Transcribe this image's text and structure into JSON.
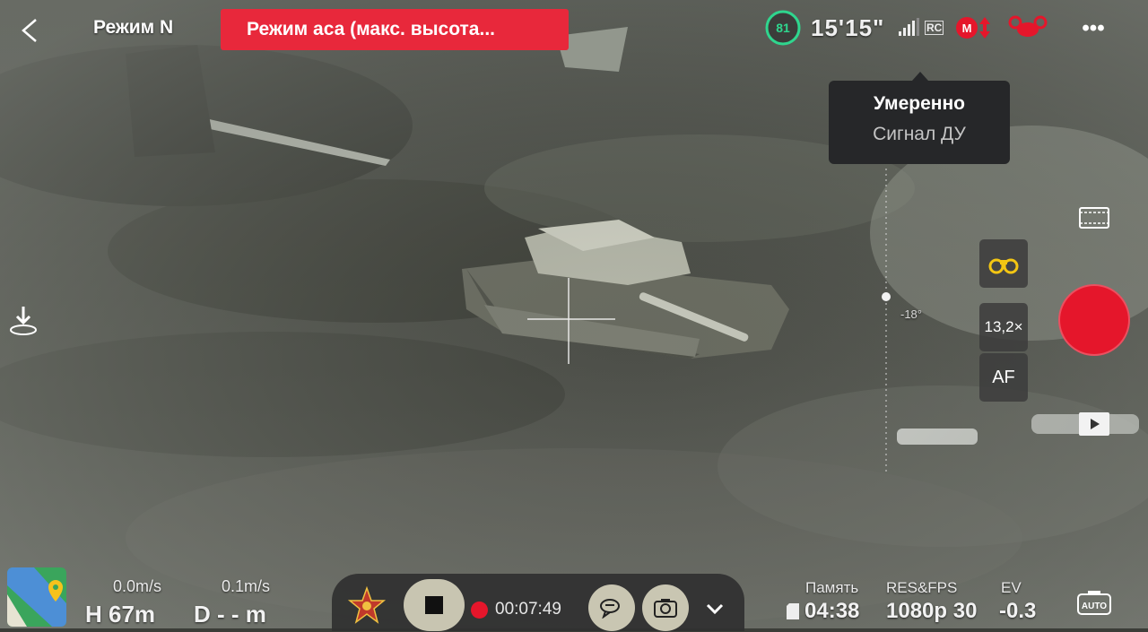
{
  "header": {
    "flight_mode": "Режим N",
    "warning_banner": "Режим аса (макс. высота...",
    "battery_percent": "81",
    "clock": "15'15\"",
    "rc_label": "RC"
  },
  "tooltip": {
    "title": "Умеренно",
    "subtitle": "Сигнал ДУ"
  },
  "gimbal": {
    "pitch": "-18°"
  },
  "camera_controls": {
    "zoom": "13,2×",
    "focus": "AF"
  },
  "telemetry": {
    "vertical_speed": "0.0m/s",
    "height": "H 67m",
    "horizontal_speed": "0.1m/s",
    "distance": "D - - m"
  },
  "media": {
    "rec_time": "00:07:49"
  },
  "status": {
    "memory_label": "Память",
    "memory_value": "04:38",
    "resfps_label": "RES&FPS",
    "resfps_value": "1080p 30",
    "ev_label": "EV",
    "ev_value": "-0.3",
    "auto_label": "AUTO"
  },
  "colors": {
    "accent_red": "#e5162b",
    "banner_red": "#e8283b",
    "battery_green": "#2fd68e",
    "tooltip_bg": "#262729"
  },
  "icons": [
    "back-arrow-icon",
    "battery-icon",
    "signal-bars-icon",
    "motor-warning-icon",
    "drone-warning-icon",
    "more-icon",
    "film-icon",
    "binoculars-icon",
    "play-icon",
    "map-icon",
    "stop-icon",
    "chat-icon",
    "camera-switch-icon",
    "chevron-down-icon",
    "auto-icon",
    "sd-card-icon",
    "landing-icon"
  ]
}
